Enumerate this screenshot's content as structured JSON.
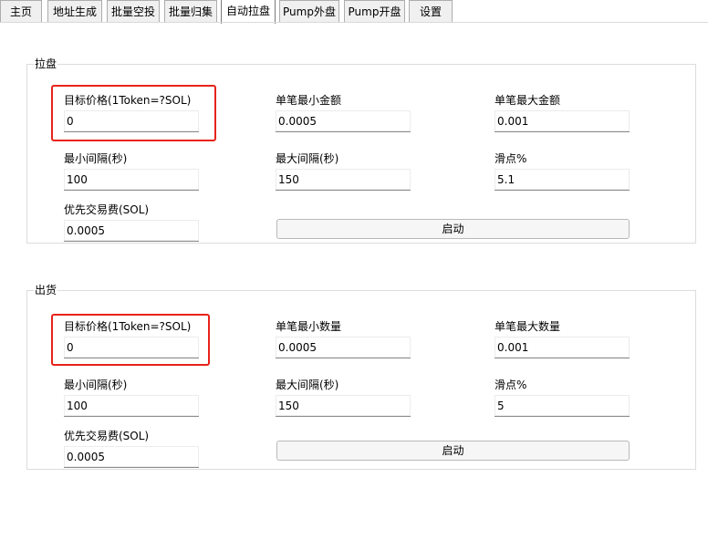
{
  "tabs": [
    "主页",
    "地址生成",
    "批量空投",
    "批量归集",
    "自动拉盘",
    "Pump外盘",
    "Pump开盘",
    "设置"
  ],
  "active_tab": "自动拉盘",
  "pull": {
    "title": "拉盘",
    "target_price_label": "目标价格(1Token=?SOL)",
    "target_price": "0",
    "min_amount_label": "单笔最小金额",
    "min_amount": "0.0005",
    "max_amount_label": "单笔最大金额",
    "max_amount": "0.001",
    "min_interval_label": "最小间隔(秒)",
    "min_interval": "100",
    "max_interval_label": "最大间隔(秒)",
    "max_interval": "150",
    "slippage_label": "滑点%",
    "slippage": "5.1",
    "priority_fee_label": "优先交易费(SOL)",
    "priority_fee": "0.0005",
    "start_label": "启动"
  },
  "sell": {
    "title": "出货",
    "target_price_label": "目标价格(1Token=?SOL)",
    "target_price": "0",
    "min_qty_label": "单笔最小数量",
    "min_qty": "0.0005",
    "max_qty_label": "单笔最大数量",
    "max_qty": "0.001",
    "min_interval_label": "最小间隔(秒)",
    "min_interval": "100",
    "max_interval_label": "最大间隔(秒)",
    "max_interval": "150",
    "slippage_label": "滑点%",
    "slippage": "5",
    "priority_fee_label": "优先交易费(SOL)",
    "priority_fee": "0.0005",
    "start_label": "启动"
  },
  "highlight_color": "#e8231a"
}
